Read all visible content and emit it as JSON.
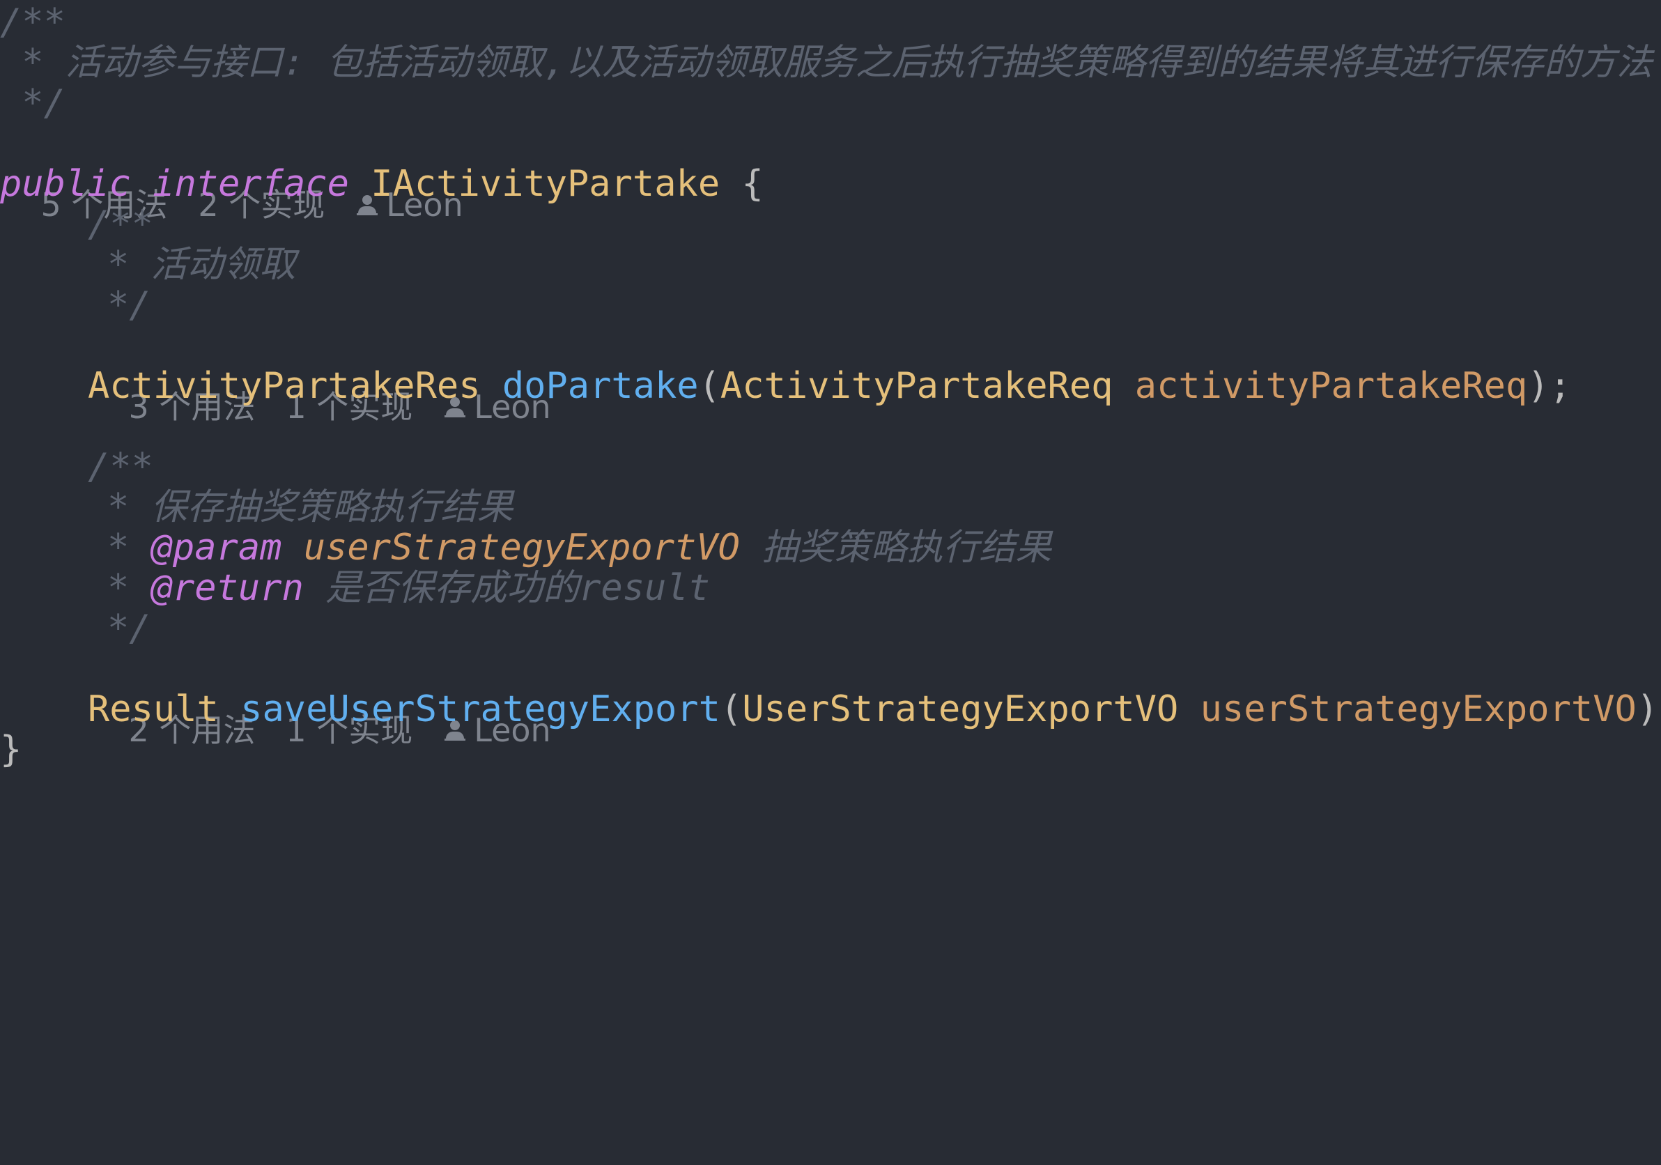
{
  "code": {
    "doc1": {
      "open": "/**",
      "text": " * 活动参与接口: 包括活动领取,以及活动领取服务之后执行抽奖策略得到的结果将其进行保存的方法",
      "close": " */"
    },
    "hint1": {
      "usages": "5 个用法",
      "impls": "2 个实现",
      "author": "Leon"
    },
    "decl": {
      "public_kw": "public",
      "interface_kw": "interface",
      "name": "IActivityPartake",
      "brace": "{"
    },
    "doc2": {
      "open": "/**",
      "text": "* 活动领取",
      "close": "*/"
    },
    "hint2": {
      "usages": "3 个用法",
      "impls": "1 个实现",
      "author": "Leon"
    },
    "method1": {
      "return_type": "ActivityPartakeRes",
      "name": "doPartake",
      "lparen": "(",
      "param_type": "ActivityPartakeReq",
      "param_name": "activityPartakeReq",
      "end": ");"
    },
    "doc3": {
      "open": "/**",
      "text": "* 保存抽奖策略执行结果",
      "star": "*",
      "param_tag": "@param",
      "param_ref": "userStrategyExportVO",
      "param_desc": "抽奖策略执行结果",
      "return_tag": "@return",
      "return_desc": "是否保存成功的result",
      "close": "*/"
    },
    "hint3": {
      "usages": "2 个用法",
      "impls": "1 个实现",
      "author": "Leon"
    },
    "method2": {
      "return_type": "Result",
      "name": "saveUserStrategyExport",
      "lparen": "(",
      "param_type": "UserStrategyExportVO",
      "param_name": "userStrategyExportVO",
      "end": ");"
    },
    "close_brace": "}"
  },
  "colors": {
    "background": "#282c34",
    "keyword": "#c678dd",
    "type": "#e5c07b",
    "function": "#61afef",
    "parameter": "#d19a66",
    "comment": "#5c6370",
    "hint": "#7f848e"
  },
  "icons": {
    "author": "user-icon"
  }
}
